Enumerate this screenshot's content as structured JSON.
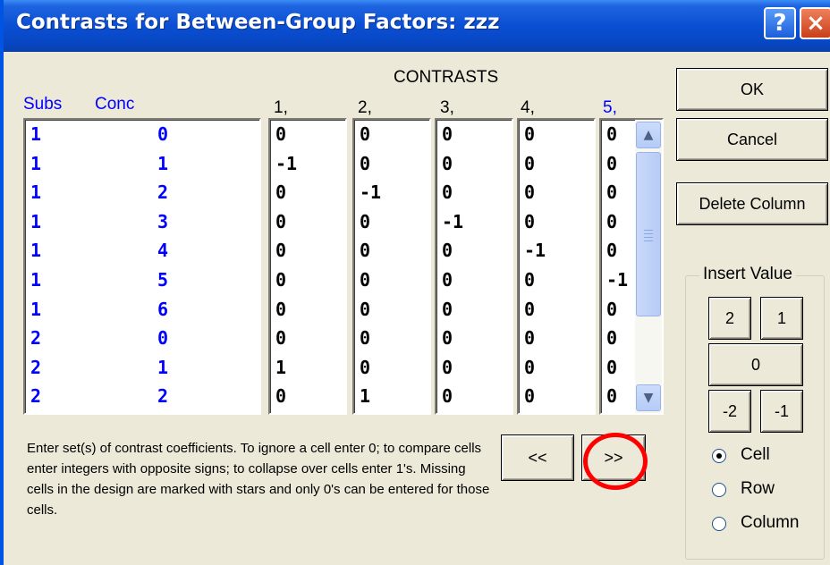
{
  "window": {
    "title": "Contrasts for Between-Group Factors: zzz",
    "help_label": "?",
    "close_label": "×"
  },
  "headers": {
    "contrasts": "CONTRASTS",
    "subs": "Subs",
    "conc": "Conc",
    "cols": [
      "1,",
      "2,",
      "3,",
      "4,",
      "5,"
    ]
  },
  "rows": [
    {
      "subs": "1",
      "conc": "0",
      "c": [
        "0",
        "0",
        "0",
        "0",
        "0"
      ]
    },
    {
      "subs": "1",
      "conc": "1",
      "c": [
        "-1",
        "0",
        "0",
        "0",
        "0"
      ]
    },
    {
      "subs": "1",
      "conc": "2",
      "c": [
        "0",
        "-1",
        "0",
        "0",
        "0"
      ]
    },
    {
      "subs": "1",
      "conc": "3",
      "c": [
        "0",
        "0",
        "-1",
        "0",
        "0"
      ]
    },
    {
      "subs": "1",
      "conc": "4",
      "c": [
        "0",
        "0",
        "0",
        "-1",
        "0"
      ]
    },
    {
      "subs": "1",
      "conc": "5",
      "c": [
        "0",
        "0",
        "0",
        "0",
        "-1"
      ]
    },
    {
      "subs": "1",
      "conc": "6",
      "c": [
        "0",
        "0",
        "0",
        "0",
        "0"
      ]
    },
    {
      "subs": "2",
      "conc": "0",
      "c": [
        "0",
        "0",
        "0",
        "0",
        "0"
      ]
    },
    {
      "subs": "2",
      "conc": "1",
      "c": [
        "1",
        "0",
        "0",
        "0",
        "0"
      ]
    },
    {
      "subs": "2",
      "conc": "2",
      "c": [
        "0",
        "1",
        "0",
        "0",
        "0"
      ]
    }
  ],
  "buttons": {
    "ok": "OK",
    "cancel": "Cancel",
    "delete_column": "Delete Column",
    "prev": "<<",
    "next": ">>"
  },
  "insert_value": {
    "legend": "Insert Value",
    "values": [
      "2",
      "1",
      "0",
      "-2",
      "-1"
    ],
    "modes": [
      {
        "label": "Cell",
        "selected": true
      },
      {
        "label": "Row",
        "selected": false
      },
      {
        "label": "Column",
        "selected": false
      }
    ]
  },
  "instructions": "Enter set(s) of contrast coefficients. To ignore a cell enter 0; to compare cells enter integers with opposite signs; to collapse over cells enter 1's. Missing cells in the design are marked with stars and only 0's can be entered for those cells.",
  "colors": {
    "title_bar": "#0a4fd3",
    "label_blue": "#0000ff",
    "highlight_circle": "#ff0000"
  }
}
